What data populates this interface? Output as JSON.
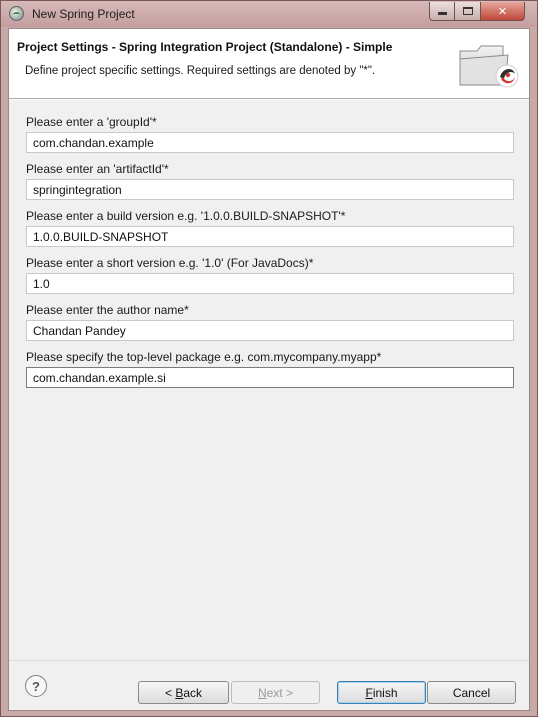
{
  "window": {
    "title": "New Spring Project",
    "controls": {
      "minimize": "minimize",
      "maximize": "maximize",
      "close": "✕"
    }
  },
  "header": {
    "title": "Project Settings - Spring Integration Project (Standalone) - Simple",
    "description": "Define project specific settings. Required settings are denoted by \"*\".",
    "icon": "folder-wizard-icon"
  },
  "fields": [
    {
      "label": "Please enter a 'groupId'*",
      "value": "com.chandan.example"
    },
    {
      "label": "Please enter an 'artifactId'*",
      "value": "springintegration"
    },
    {
      "label": "Please enter a build version e.g. '1.0.0.BUILD-SNAPSHOT'*",
      "value": "1.0.0.BUILD-SNAPSHOT"
    },
    {
      "label": "Please enter a short version e.g. '1.0' (For JavaDocs)*",
      "value": "1.0"
    },
    {
      "label": "Please enter the author name*",
      "value": "Chandan Pandey"
    },
    {
      "label": "Please specify the top-level package e.g. com.mycompany.myapp*",
      "value": "com.chandan.example.si"
    }
  ],
  "footer": {
    "help": "?",
    "back_mnemonic": "B",
    "back_rest": "ack",
    "back_prefix": "< ",
    "next_mnemonic": "N",
    "next_rest": "ext >",
    "finish_mnemonic": "F",
    "finish_rest": "inish",
    "cancel": "Cancel"
  },
  "colors": {
    "title_bar": "#c9a8a8",
    "close_button": "#c2463a",
    "dialog_background": "#f0f0f0",
    "default_button_border": "#3c7fb1"
  }
}
